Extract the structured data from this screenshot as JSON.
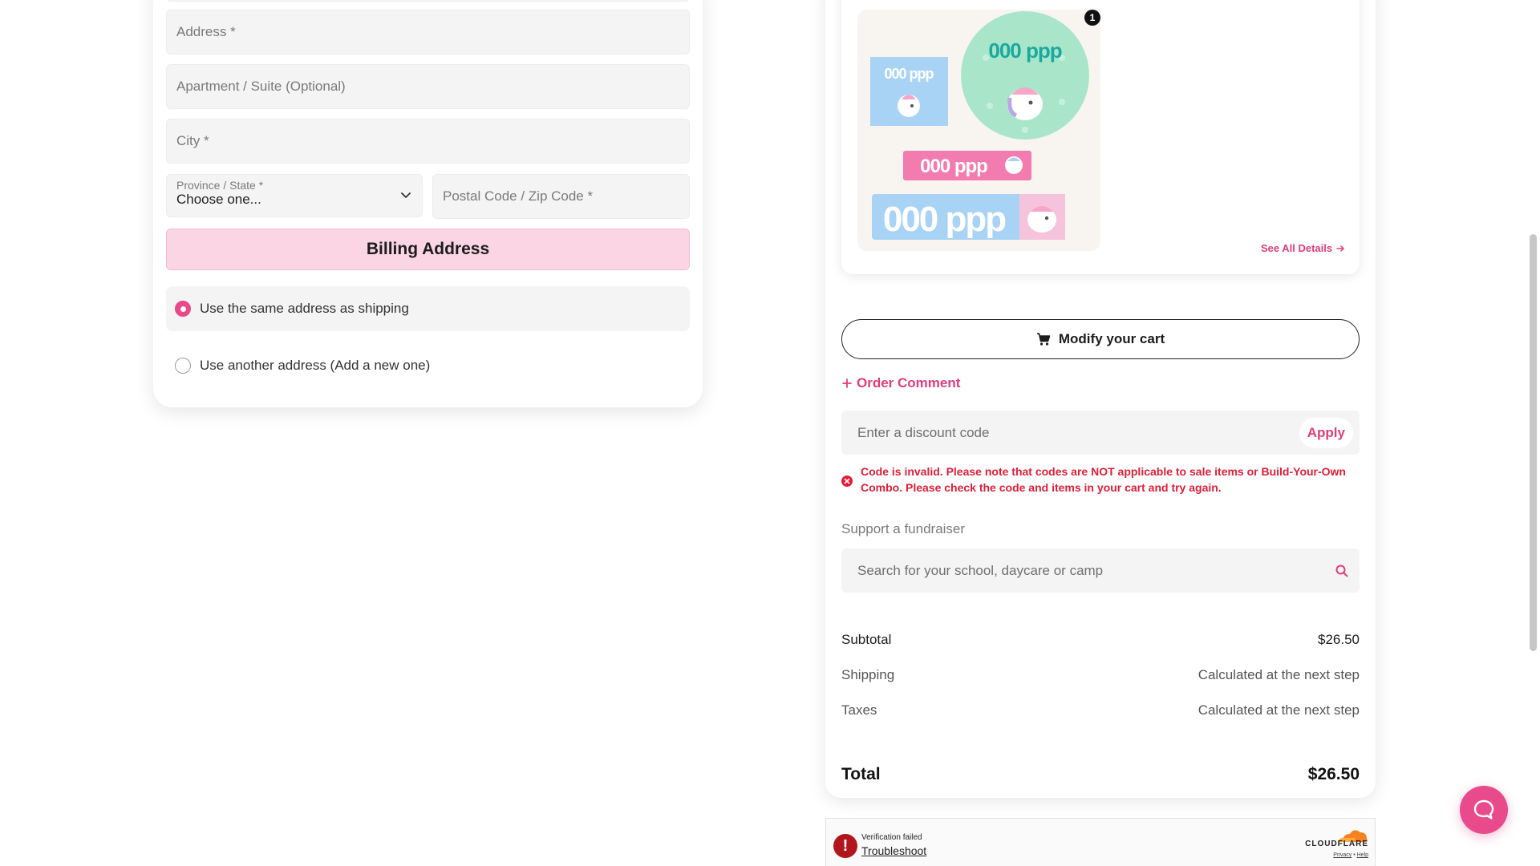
{
  "shipping_form": {
    "address_placeholder": "Address *",
    "apartment_placeholder": "Apartment / Suite (Optional)",
    "city_placeholder": "City *",
    "province": {
      "label": "Province / State *",
      "value": "Choose one..."
    },
    "postal_placeholder": "Postal Code / Zip Code *"
  },
  "billing": {
    "header": "Billing Address",
    "options": [
      {
        "label": "Use the same address as shipping",
        "selected": true
      },
      {
        "label": "Use another address (Add a new one)",
        "selected": false
      }
    ]
  },
  "cart_item": {
    "quantity": "1",
    "see_all_label": "See All Details",
    "label_texts": {
      "small_square": "000 ppp",
      "circle": "000 ppp",
      "pink_strip": "000 ppp",
      "blue_strip": "000 ppp"
    }
  },
  "actions": {
    "modify_cart_label": "Modify your cart",
    "order_comment_label": "Order Comment"
  },
  "discount": {
    "placeholder": "Enter a discount code",
    "apply_label": "Apply",
    "error_message": "Code is invalid. Please note that codes are NOT applicable to sale items or Build-Your-Own Combo. Please check the code and items in your cart and try again."
  },
  "fundraiser": {
    "label": "Support a fundraiser",
    "placeholder": "Search for your school, daycare or camp"
  },
  "summary": {
    "subtotal_label": "Subtotal",
    "subtotal_value": "$26.50",
    "shipping_label": "Shipping",
    "shipping_value": "Calculated at the next step",
    "taxes_label": "Taxes",
    "taxes_value": "Calculated at the next step",
    "total_label": "Total",
    "total_value": "$26.50"
  },
  "cloudflare": {
    "status": "Verification failed",
    "troubleshoot_label": "Troubleshoot",
    "brand": "CLOUDFLARE",
    "privacy_label": "Privacy",
    "help_label": "Help"
  },
  "colors": {
    "accent": "#e94a8b",
    "accent_text": "#e23c7a",
    "billing_header_bg": "#fbd5e3",
    "error": "#e01e37",
    "field_bg": "#f4f4f4"
  },
  "icons": [
    "chevron-down-icon",
    "cart-icon",
    "plus-icon",
    "arrow-right-icon",
    "error-circle-icon",
    "search-icon",
    "chat-icon",
    "cloudflare-logo-icon",
    "alert-icon"
  ]
}
